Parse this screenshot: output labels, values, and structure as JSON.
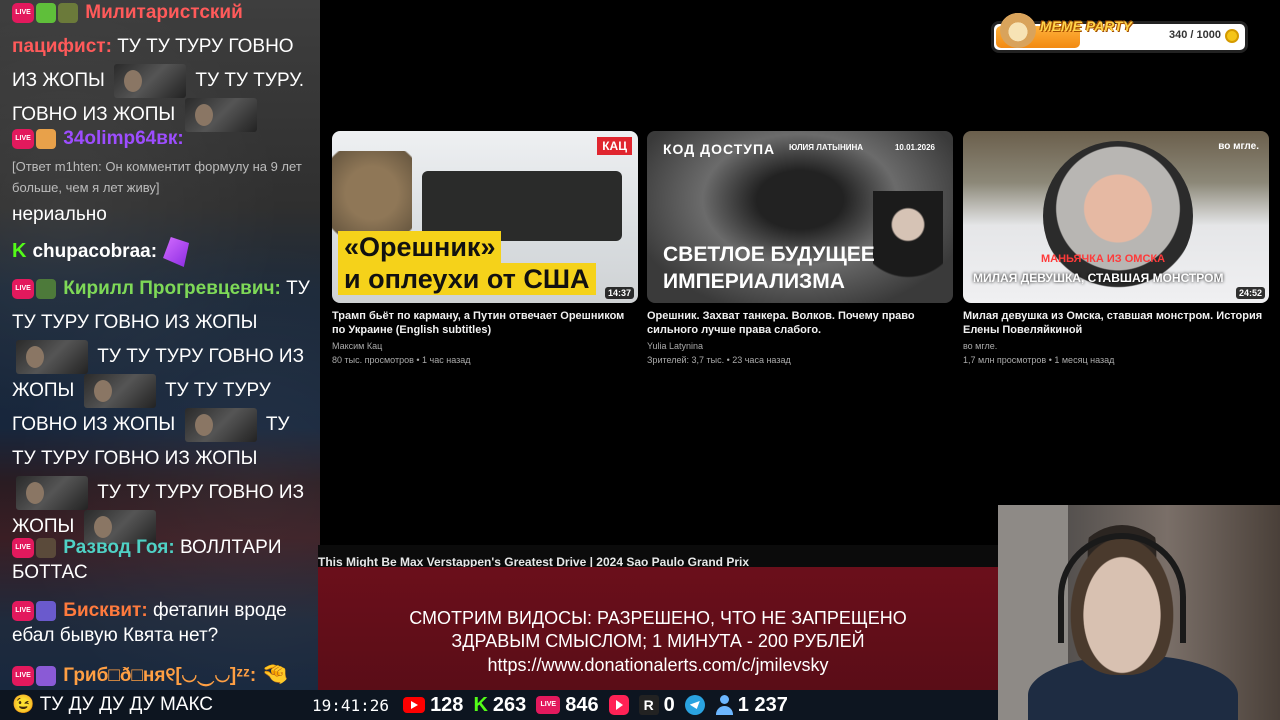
{
  "chat": {
    "messages": [
      {
        "nick": "Милитаристский пацифист:",
        "nick_color": "#ff5a5a",
        "text_parts": [
          "ТУ ТУ ТУРУ ГОВНО ИЗ ЖОПЫ",
          "ТУ ТУ ТУРУ.",
          "ГОВНО ИЗ ЖОПЫ"
        ]
      },
      {
        "nick": "34olimp64вк:",
        "nick_color": "#9d4dff",
        "reply": "[Ответ m1hten: Он комментит формулу на 9 лет больше, чем я лет живу]",
        "text": "нериально"
      },
      {
        "nick": "chupacobraa:",
        "nick_color": "#ffffff"
      },
      {
        "nick": "Кирилл Прогревцевич:",
        "nick_color": "#7ed957",
        "text_parts": [
          "ТУ ТУ ТУРУ ГОВНО ИЗ ЖОПЫ",
          "ТУ ТУ ТУРУ ГОВНО ИЗ",
          "ЖОПЫ",
          "ТУ ТУ ТУРУ",
          "ГОВНО ИЗ ЖОПЫ",
          "ТУ",
          "ТУ ТУРУ ГОВНО ИЗ ЖОПЫ",
          "ТУ ТУ ТУРУ ГОВНО ИЗ",
          "ЖОПЫ"
        ]
      },
      {
        "nick": "Развод Гоя:",
        "nick_color": "#4fd1c5",
        "text": "ВОЛЛТАРИ БОТТАС"
      },
      {
        "nick": "Бисквит:",
        "nick_color": "#ff7a3d",
        "text": "фетапин вроде ебал бывую Квята нет?"
      },
      {
        "nick": "Гриб□ð□ня୧[◡‿◡]ᶻᶻ:",
        "nick_color": "#ff9f43"
      },
      {
        "text": "ТУ ДУ ДУ ДУ МАКС"
      }
    ]
  },
  "videos": [
    {
      "thumb_badge": "КАЦ",
      "thumb_line1": "«Орешник»",
      "thumb_line2": "и оплеухи от США",
      "duration": "14:37",
      "title": "Трамп бьёт по карману, а Путин отвечает Орешником по Украине (English subtitles)",
      "channel": "Максим Кац",
      "meta": "80 тыс. просмотров • 1 час назад"
    },
    {
      "thumb_logo": "КОД ДОСТУПА",
      "thumb_author": "ЮЛИЯ ЛАТЫНИНА",
      "thumb_date": "10.01.2026",
      "thumb_title": "СВЕТЛОЕ БУДУЩЕЕ ИМПЕРИАЛИЗМА",
      "title": "Орешник. Захват танкера. Волков. Почему право сильного лучше права слабого.",
      "channel": "Yulia Latynina",
      "meta": "Зрителей: 3,7 тыс. • 23 часа назад"
    },
    {
      "thumb_brand": "во мгле.",
      "thumb_tag": "маньячка из омска",
      "thumb_title": "МИЛАЯ ДЕВУШКА, СТАВШАЯ МОНСТРОМ",
      "duration": "24:52",
      "title": "Милая девушка из Омска, ставшая монстром. История Елены Повеляйкиной",
      "channel": "во мгле.",
      "meta": "1,7 млн просмотров • 1 месяц назад"
    }
  ],
  "now_playing": "This Might Be Max Verstappen's Greatest Drive | 2024 Sao Paulo Grand Prix",
  "rules": {
    "line1": "СМОТРИМ ВИДОСЫ: РАЗРЕШЕНО, ЧТО НЕ ЗАПРЕЩЕНО",
    "line2": "ЗДРАВЫМ СМЫСЛОМ; 1 МИНУТА - 200 РУБЛЕЙ",
    "line3": "https://www.donationalerts.com/c/jmilevsky"
  },
  "stats": {
    "clock": "19:41:26",
    "youtube": "128",
    "kick": "263",
    "vk_live": "846",
    "rumble": "0",
    "total": "1 237",
    "live_badge": "LIVE",
    "rumble_letter": "R"
  },
  "meme_party": {
    "label": "MEME PARTY",
    "progress_text": "340 / 1000",
    "progress": 0.34
  },
  "colors": {
    "live": "#e3195d",
    "kick": "#53fc18",
    "youtube": "#ff0000",
    "rules_bg": "#6b0f1b"
  }
}
